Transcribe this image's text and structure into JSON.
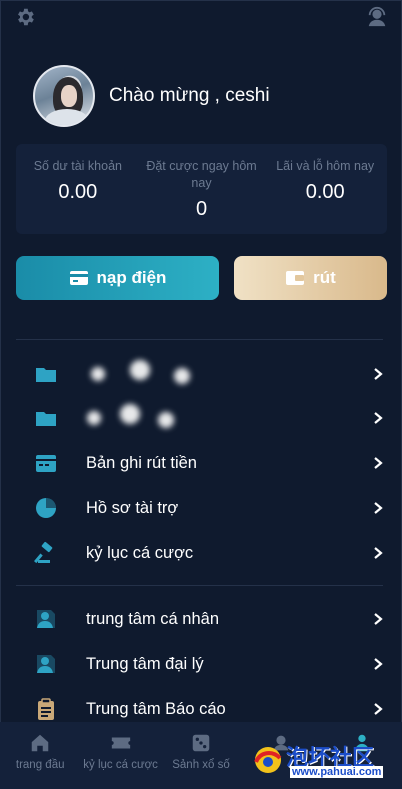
{
  "header": {
    "settings_icon": "gear-icon",
    "support_icon": "user-headset-icon"
  },
  "profile": {
    "greeting": "Chào mừng , ceshi"
  },
  "stats": [
    {
      "label": "Số dư tài khoản",
      "value": "0.00"
    },
    {
      "label": "Đặt cược ngay hôm nay",
      "value": "0"
    },
    {
      "label": "Lãi và lỗ hôm nay",
      "value": "0.00"
    }
  ],
  "actions": {
    "deposit_label": "nạp điện",
    "withdraw_label": "rút"
  },
  "menu": {
    "group1": [
      {
        "label": "Bản ghi rút tiền",
        "icon": "calendar-icon"
      },
      {
        "label": "Hồ sơ tài trợ",
        "icon": "pie-chart-icon"
      },
      {
        "label": "kỷ lục cá cược",
        "icon": "gavel-icon"
      }
    ],
    "group2": [
      {
        "label": "trung tâm cá nhân",
        "icon": "person-icon"
      },
      {
        "label": "Trung tâm đại lý",
        "icon": "person-icon"
      },
      {
        "label": "Trung tâm Báo cáo",
        "icon": "clipboard-icon"
      }
    ]
  },
  "tabs": [
    {
      "label": "trang đầu",
      "icon": "home-icon"
    },
    {
      "label": "kỷ lục cá cược",
      "icon": "ticket-icon"
    },
    {
      "label": "Sảnh xổ số",
      "icon": "dice-icon"
    },
    {
      "label": "",
      "icon": "headset-icon"
    },
    {
      "label": "",
      "icon": "person-icon"
    }
  ],
  "watermark": {
    "text": "泡坏社区",
    "url": "www.pahuai.com"
  },
  "colors": {
    "accent": "#2db0c5",
    "gold": "#d9b98b",
    "background": "#0f1a2e",
    "panel": "#14213a"
  }
}
